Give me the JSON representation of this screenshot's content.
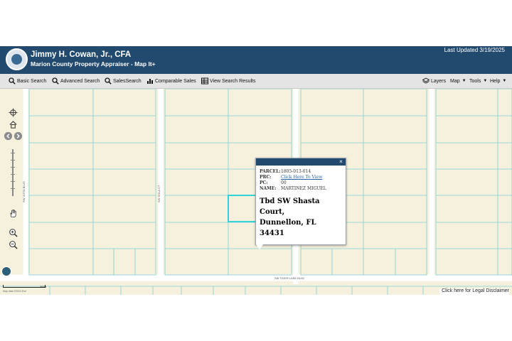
{
  "header": {
    "title": "Jimmy H. Cowan, Jr., CFA",
    "subtitle": "Marion County Property Appraiser - Map It+",
    "last_updated": "Last Updated 3/19/2025",
    "logo_icon": "county-seal-icon"
  },
  "toolbar": {
    "basic_search": "Basic Search",
    "advanced_search": "Advanced Search",
    "sales_search": "SalesSearch",
    "comparable_sales": "Comparable Sales",
    "view_results": "View Search Results",
    "layers": "Layers",
    "map": "Map",
    "tools": "Tools",
    "help": "Help"
  },
  "map": {
    "roads": {
      "west": "SW VISTA BLVD",
      "middle": "SW SOLA CT",
      "bottom": "SW TIGER LAKE BLVD"
    },
    "scale_label": "300ft",
    "copyright": "Map data ©2024 Esri",
    "parcel_outline_color": "#32d3d6",
    "parcel_line_color": "#7ecfd4",
    "road_color": "#ffffff"
  },
  "popup": {
    "rows": [
      {
        "key": "PARCEL:",
        "value": "1805-013-014"
      },
      {
        "key": "PRC:",
        "value": "Click Here To View"
      },
      {
        "key": "PC:",
        "value": "00"
      },
      {
        "key": "NAME:",
        "value": "MARTINEZ MIGUEL"
      }
    ],
    "address_line1": "Tbd SW Shasta Court,",
    "address_line2": "Dunnellon, FL 34431",
    "close": "×"
  },
  "footer": {
    "disclaimer": "Click here for Legal Disclaimer"
  }
}
